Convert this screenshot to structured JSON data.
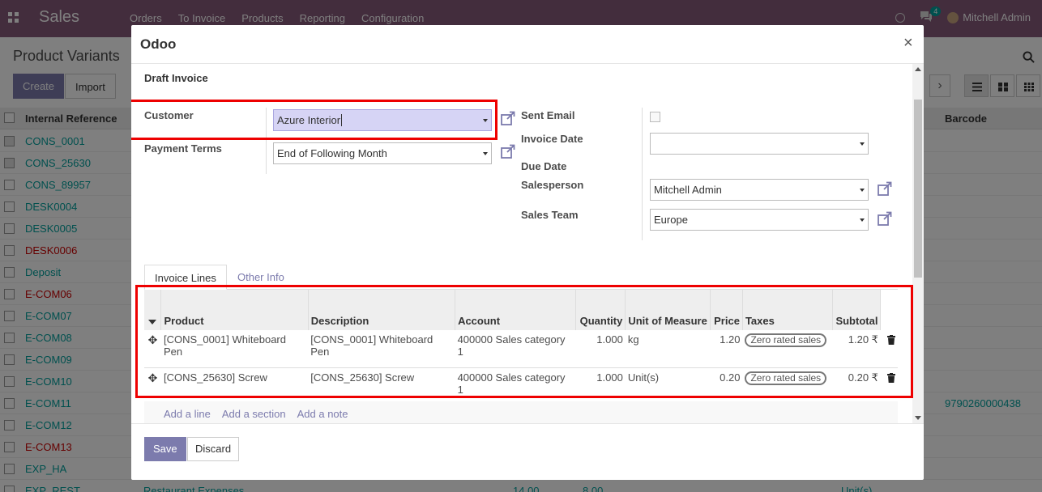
{
  "navbar": {
    "app_name": "Sales",
    "menu": [
      "Orders",
      "To Invoice",
      "Products",
      "Reporting",
      "Configuration"
    ],
    "chat_count": "4",
    "user_name": "Mitchell Admin",
    "bg_color": "#875a7b"
  },
  "list": {
    "title": "Product Variants",
    "create_label": "Create",
    "import_label": "Import",
    "col_ref": "Internal Reference",
    "col_barcode": "Barcode",
    "rows": [
      {
        "ref": "CONS_0001",
        "checked": true,
        "red": false
      },
      {
        "ref": "CONS_25630",
        "checked": true,
        "red": false
      },
      {
        "ref": "CONS_89957",
        "checked": false,
        "red": false
      },
      {
        "ref": "DESK0004",
        "checked": false,
        "red": false
      },
      {
        "ref": "DESK0005",
        "checked": false,
        "red": false
      },
      {
        "ref": "DESK0006",
        "checked": false,
        "red": true
      },
      {
        "ref": "Deposit",
        "checked": false,
        "red": false
      },
      {
        "ref": "E-COM06",
        "checked": false,
        "red": true
      },
      {
        "ref": "E-COM07",
        "checked": false,
        "red": false
      },
      {
        "ref": "E-COM08",
        "checked": false,
        "red": false
      },
      {
        "ref": "E-COM09",
        "checked": false,
        "red": false
      },
      {
        "ref": "E-COM10",
        "checked": false,
        "red": false
      },
      {
        "ref": "E-COM11",
        "checked": false,
        "red": false,
        "barcode": "9790260000438"
      },
      {
        "ref": "E-COM12",
        "checked": false,
        "red": false
      },
      {
        "ref": "E-COM13",
        "checked": false,
        "red": true
      },
      {
        "ref": "EXP_HA",
        "checked": false,
        "red": false
      },
      {
        "ref": "EXP_REST",
        "checked": false,
        "red": false,
        "name": "Restaurant Expenses",
        "price": "14.00",
        "cost": "8.00",
        "uom": "Unit(s)"
      }
    ]
  },
  "modal": {
    "title": "Odoo",
    "close": "×",
    "status": "Draft Invoice",
    "customer_label": "Customer",
    "customer_value": "Azure Interior",
    "payment_terms_label": "Payment Terms",
    "payment_terms_value": "End of Following Month",
    "sent_email_label": "Sent Email",
    "invoice_date_label": "Invoice Date",
    "invoice_date_value": "",
    "due_date_label": "Due Date",
    "salesperson_label": "Salesperson",
    "salesperson_value": "Mitchell Admin",
    "sales_team_label": "Sales Team",
    "sales_team_value": "Europe",
    "tab_lines": "Invoice Lines",
    "tab_other": "Other Info",
    "columns": {
      "product": "Product",
      "description": "Description",
      "account": "Account",
      "quantity": "Quantity",
      "uom": "Unit of Measure",
      "price": "Price",
      "taxes": "Taxes",
      "subtotal": "Subtotal"
    },
    "lines": [
      {
        "product": "[CONS_0001] Whiteboard Pen",
        "description": "[CONS_0001] Whiteboard Pen",
        "account": "400000 Sales category 1",
        "quantity": "1.000",
        "uom": "kg",
        "price": "1.20",
        "tax": "Zero rated sales",
        "subtotal": "1.20 ₹"
      },
      {
        "product": "[CONS_25630] Screw",
        "description": "[CONS_25630] Screw",
        "account": "400000 Sales category 1",
        "quantity": "1.000",
        "uom": "Unit(s)",
        "price": "0.20",
        "tax": "Zero rated sales",
        "subtotal": "0.20 ₹"
      }
    ],
    "add_line": "Add a line",
    "add_section": "Add a section",
    "add_note": "Add a note",
    "save_label": "Save",
    "discard_label": "Discard"
  }
}
